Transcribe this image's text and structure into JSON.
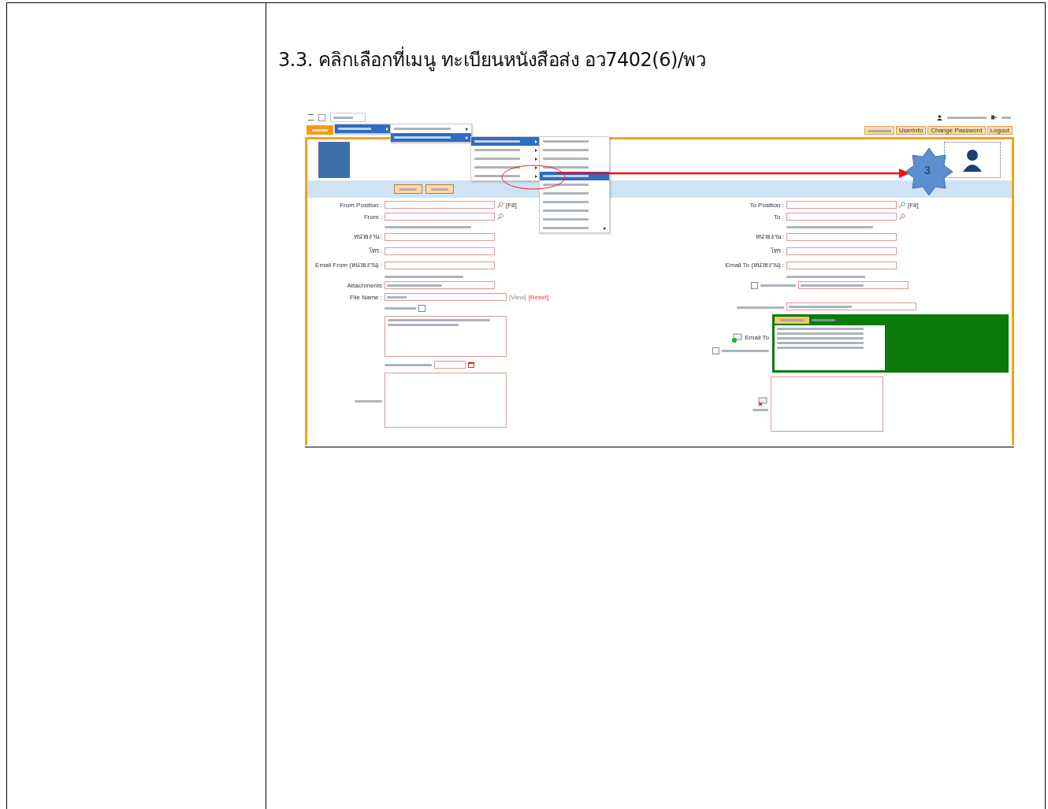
{
  "heading": "3.3. คลิกเลือกที่เมนู ทะเบียนหนังสือส่ง อว7402(6)/พว",
  "app": {
    "top_links": [
      {
        "label": "UserInfo"
      },
      {
        "label": "Change Password"
      },
      {
        "label": "Logout"
      }
    ],
    "menus": [
      {
        "items": [
          {
            "selected": true,
            "submenu": true
          }
        ]
      },
      {
        "items": [
          {
            "selected": false,
            "submenu": true
          },
          {
            "selected": true,
            "submenu": true
          }
        ]
      },
      {
        "items": [
          {
            "selected": true,
            "submenu": true
          },
          {
            "selected": false,
            "submenu": true
          },
          {
            "selected": false,
            "submenu": true
          },
          {
            "selected": false,
            "submenu": true
          },
          {
            "selected": false,
            "submenu": true
          }
        ]
      },
      {
        "items": [
          {
            "selected": false,
            "submenu": false
          },
          {
            "selected": false,
            "submenu": false
          },
          {
            "selected": false,
            "submenu": false
          },
          {
            "selected": false,
            "submenu": false
          },
          {
            "selected": true,
            "submenu": false
          },
          {
            "selected": false,
            "submenu": false
          },
          {
            "selected": false,
            "submenu": false
          },
          {
            "selected": false,
            "submenu": false
          },
          {
            "selected": false,
            "submenu": false
          },
          {
            "selected": false,
            "submenu": false
          },
          {
            "selected": false,
            "submenu": true
          }
        ]
      }
    ],
    "step_badge": "3",
    "from_fields": [
      {
        "label": "From Position :",
        "kind": "lookup",
        "suffix": "[F8]"
      },
      {
        "label": "From :",
        "kind": "lookup"
      },
      {
        "label": "หน่วยงาน :",
        "kind": "text"
      },
      {
        "label": "โทร :",
        "kind": "text"
      },
      {
        "label": "Email From (หน่วยงาน) :",
        "kind": "text"
      }
    ],
    "attachment_label": "Attachments",
    "checkboxes": [
      {
        "checked": false
      },
      {
        "checked": false
      },
      {
        "checked": false
      }
    ],
    "file": {
      "label": "File Name :",
      "links": [
        "[View]",
        "[Reset]"
      ]
    },
    "to_fields": [
      {
        "label": "To Position :",
        "kind": "lookup",
        "suffix": "[F8]"
      },
      {
        "label": "To :",
        "kind": "lookup"
      },
      {
        "label": "หน่วยงาน :",
        "kind": "text"
      },
      {
        "label": "โทร :",
        "kind": "text"
      },
      {
        "label": "Email To (หน่วยงาน) :",
        "kind": "text"
      }
    ],
    "email_to_label": "Email To"
  }
}
